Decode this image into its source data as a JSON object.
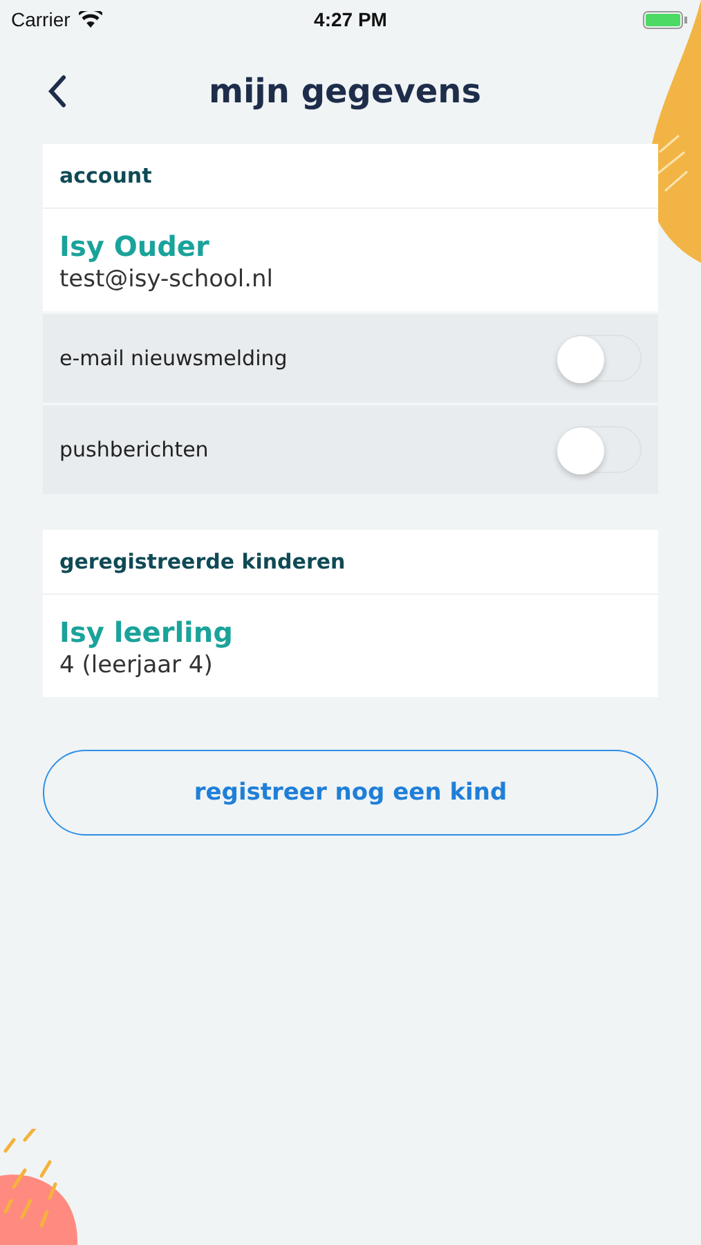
{
  "status_bar": {
    "carrier": "Carrier",
    "time": "4:27 PM"
  },
  "header": {
    "title": "mijn gegevens"
  },
  "account": {
    "heading": "account",
    "name": "Isy Ouder",
    "email": "test@isy-school.nl",
    "toggles": [
      {
        "label": "e-mail nieuwsmelding",
        "on": false
      },
      {
        "label": "pushberichten",
        "on": false
      }
    ]
  },
  "children": {
    "heading": "geregistreerde kinderen",
    "items": [
      {
        "name": "Isy leerling",
        "detail": "4 (leerjaar 4)"
      }
    ]
  },
  "register_button": "registreer nog een kind"
}
